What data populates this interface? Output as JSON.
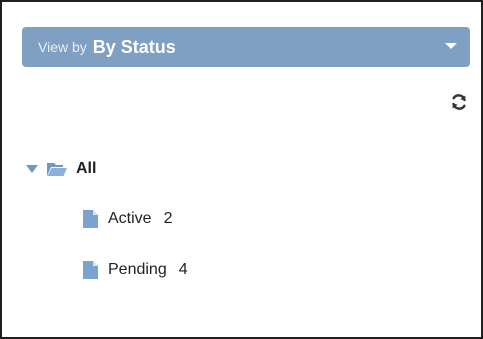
{
  "view_by": {
    "prefix": "View by",
    "value": "By Status",
    "icon": "chevron-down-icon"
  },
  "toolbar": {
    "refresh_icon": "refresh-icon"
  },
  "tree": {
    "root": {
      "label": "All",
      "expanded": true,
      "icon": "folder-open-icon"
    },
    "items": [
      {
        "label": "Active",
        "count": "2",
        "icon": "file-icon"
      },
      {
        "label": "Pending",
        "count": "4",
        "icon": "file-icon"
      }
    ]
  },
  "colors": {
    "bar_background": "#7f9fc3",
    "icon_blue": "#6f98c7",
    "text": "#222222"
  }
}
